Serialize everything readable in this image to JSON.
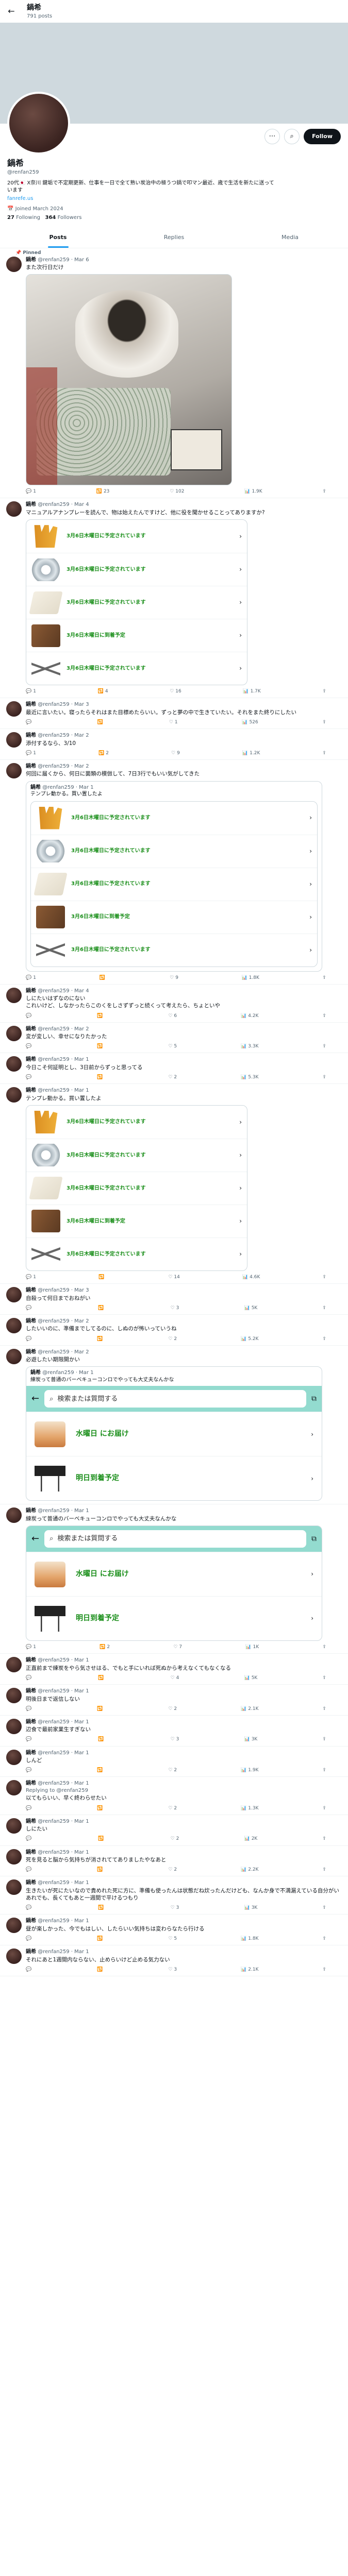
{
  "header": {
    "back": "←",
    "name": "鍋希",
    "posts": "791 posts"
  },
  "profile": {
    "follow": "Follow",
    "name": "鍋希",
    "handle": "@renfan259",
    "bio": "20代🇯🇵 X奈川 鍵垢で不定期更新、仕事を一日で全て熟い炭治中の極うつ鍋で叩マン最近、歳で生活を新たに送っています",
    "link": "fanrefe.us",
    "joined": "📅 Joined March 2024",
    "following": "27",
    "following_label": "Following",
    "followers": "364",
    "followers_label": "Followers"
  },
  "tabs": [
    "Posts",
    "Replies",
    "Media"
  ],
  "colors": {
    "accent": "#1d9bf0",
    "product_green": "#1b8f1b",
    "amazon_teal": "#93dbcf"
  },
  "posts": [
    {
      "pinned": "📌 Pinned",
      "name": "鍋希",
      "meta": "@renfan259 · Mar 6",
      "text": "また次行日だけ",
      "stats": [
        "1",
        "23",
        "102",
        "1.9K"
      ]
    },
    {
      "name": "鍋希",
      "meta": "@renfan259 · Mar 4",
      "text": "マニュアルアナンプレーを読んで、物は始えたんですけど、他に役を聞かせることってありますか?",
      "stats": [
        "1",
        "4",
        "16",
        "1.7K"
      ],
      "products": [
        {
          "icon": "glove",
          "label": "3月6日木曜日に予定されています"
        },
        {
          "icon": "tape",
          "label": "3月6日木曜日に予定されています"
        },
        {
          "icon": "sheet",
          "label": "3月6日木曜日に予定されています"
        },
        {
          "icon": "box",
          "label": "3月6日木曜日に到着予定"
        },
        {
          "icon": "tongs",
          "label": "3月6日木曜日に予定されています"
        }
      ]
    },
    {
      "name": "鍋希",
      "meta": "@renfan259 · Mar 3",
      "text": "最近に言いたい。寝ったらそれはまた目標めたらいい。ずっと夢の中で生きていたい。それをまた終りにしたい",
      "stats": [
        "",
        "",
        "1",
        "526"
      ]
    },
    {
      "name": "鍋希",
      "meta": "@renfan259 · Mar 2",
      "text": "添付するなら、3/10",
      "stats": [
        "1",
        "2",
        "9",
        "1.2K"
      ]
    },
    {
      "name": "鍋希",
      "meta": "@renfan259 · Mar 2",
      "text": "何回に届くから、何日に菌類の模倣して、7日3行でもいい気がしてきた",
      "stats": [
        "1",
        "",
        "9",
        "1.8K"
      ],
      "quote": {
        "name": "鍋希",
        "meta": "@renfan259 · Mar 1",
        "text": "テンプレ動かる。買い置したよ",
        "products": [
          {
            "icon": "glove",
            "label": "3月6日木曜日に予定されています"
          },
          {
            "icon": "tape",
            "label": "3月6日木曜日に予定されています"
          },
          {
            "icon": "sheet",
            "label": "3月6日木曜日に予定されています"
          },
          {
            "icon": "box",
            "label": "3月6日木曜日に到着予定"
          },
          {
            "icon": "tongs",
            "label": "3月6日木曜日に予定されています"
          }
        ]
      }
    },
    {
      "name": "鍋希",
      "meta": "@renfan259 · Mar 4",
      "text": "しにたいはずなのにない\nこれいけど、しなかったらこのくをしさずずっと続くって考えたら、ちょといや",
      "stats": [
        "",
        "",
        "6",
        "4.2K"
      ]
    },
    {
      "name": "鍋希",
      "meta": "@renfan259 · Mar 2",
      "text": "変が変しい、幸せになりたかった",
      "stats": [
        "",
        "",
        "5",
        "3.3K"
      ]
    },
    {
      "name": "鍋希",
      "meta": "@renfan259 · Mar 1",
      "text": "今日こそ何証明とし、3日前からずっと思ってる",
      "stats": [
        "",
        "",
        "2",
        "5.3K"
      ]
    },
    {
      "name": "鍋希",
      "meta": "@renfan259 · Mar 1",
      "text": "テンプレ動かる。買い置したよ",
      "stats": [
        "1",
        "",
        "14",
        "4.6K"
      ],
      "products": [
        {
          "icon": "glove",
          "label": "3月6日木曜日に予定されています"
        },
        {
          "icon": "tape",
          "label": "3月6日木曜日に予定されています"
        },
        {
          "icon": "sheet",
          "label": "3月6日木曜日に予定されています"
        },
        {
          "icon": "box",
          "label": "3月6日木曜日に到着予定"
        },
        {
          "icon": "tongs",
          "label": "3月6日木曜日に予定されています"
        }
      ]
    },
    {
      "name": "鍋希",
      "meta": "@renfan259 · Mar 3",
      "text": "自殺って何日までおねがい",
      "stats": [
        "",
        "",
        "3",
        "5K"
      ]
    },
    {
      "name": "鍋希",
      "meta": "@renfan259 · Mar 2",
      "text": "したいいのに、準備までしてるのに、しぬのが怖いっていうね",
      "stats": [
        "",
        "",
        "2",
        "5.2K"
      ]
    },
    {
      "name": "鍋希",
      "meta": "@renfan259 · Mar 2",
      "text": "必遊したい期限開かい",
      "stats": [],
      "amazon": {
        "name": "鍋希",
        "meta": "@renfan259 · Mar 1",
        "text": "練炭って普通のバーベキューコンロでやっても大丈夫なんかな",
        "search": "検索または質問する",
        "items": [
          {
            "icon": "bacon",
            "label": "水曜日 にお届け"
          },
          {
            "icon": "grill",
            "label": "明日到着予定"
          }
        ]
      }
    },
    {
      "name": "鍋希",
      "meta": "@renfan259 · Mar 1",
      "text": "練炭って普通のバーベキューコンロでやっても大丈夫なんかな",
      "stats": [
        "1",
        "2",
        "7",
        "1K"
      ],
      "amazon": {
        "search": "検索または質問する",
        "items": [
          {
            "icon": "bacon",
            "label": "水曜日 にお届け"
          },
          {
            "icon": "grill",
            "label": "明日到着予定"
          }
        ]
      }
    },
    {
      "name": "鍋希",
      "meta": "@renfan259 · Mar 1",
      "text": "正直前まで練炭をやら気させはる、でもと手にいれば死ぬから考えなくてもなくなる",
      "stats": [
        "",
        "",
        "4",
        "5K"
      ]
    },
    {
      "name": "鍋希",
      "meta": "@renfan259 · Mar 1",
      "text": "明後日まで返信しない",
      "stats": [
        "",
        "",
        "2",
        "2.1K"
      ]
    },
    {
      "name": "鍋希",
      "meta": "@renfan259 · Mar 1",
      "text": "辺食で最前家業生すぎない",
      "stats": [
        "",
        "",
        "3",
        "3K"
      ]
    },
    {
      "name": "鍋希",
      "meta": "@renfan259 · Mar 1",
      "text": "しんど",
      "stats": [
        "",
        "",
        "2",
        "1.9K"
      ]
    },
    {
      "name": "鍋希",
      "meta": "@renfan259 · Mar 1",
      "reply": "Replying to @renfan259",
      "text": "以てもらいい、早く終わらせたい",
      "stats": [
        "",
        "",
        "2",
        "1.3K"
      ]
    },
    {
      "name": "鍋希",
      "meta": "@renfan259 · Mar 1",
      "text": "しにたい",
      "stats": [
        "",
        "",
        "2",
        "2K"
      ]
    },
    {
      "name": "鍋希",
      "meta": "@renfan259 · Mar 1",
      "text": "死を見ると脳から気持ちが消されててありましたやなあと",
      "stats": [
        "",
        "",
        "2",
        "2.2K"
      ]
    },
    {
      "name": "鍋希",
      "meta": "@renfan259 · Mar 1",
      "text": "生きたいが死にたいなので貴めれた死に方に、準備も使ったんは状態だね炊ったんだけども、なんか身で不満漏えている自分がいあれでも、長くてもあと一週間で平けるつもり",
      "stats": [
        "",
        "",
        "3",
        "3K"
      ]
    },
    {
      "name": "鍋希",
      "meta": "@renfan259 · Mar 1",
      "text": "昼が楽しかった、今でもはしい、したらいい気持ちは変わらなたら行ける",
      "stats": [
        "",
        "",
        "5",
        "1.8K"
      ]
    },
    {
      "name": "鍋希",
      "meta": "@renfan259 · Mar 1",
      "text": "それにあと1週間内ならない、止めらいけど止める気力ない",
      "stats": [
        "",
        "",
        "3",
        "2.1K"
      ]
    }
  ]
}
